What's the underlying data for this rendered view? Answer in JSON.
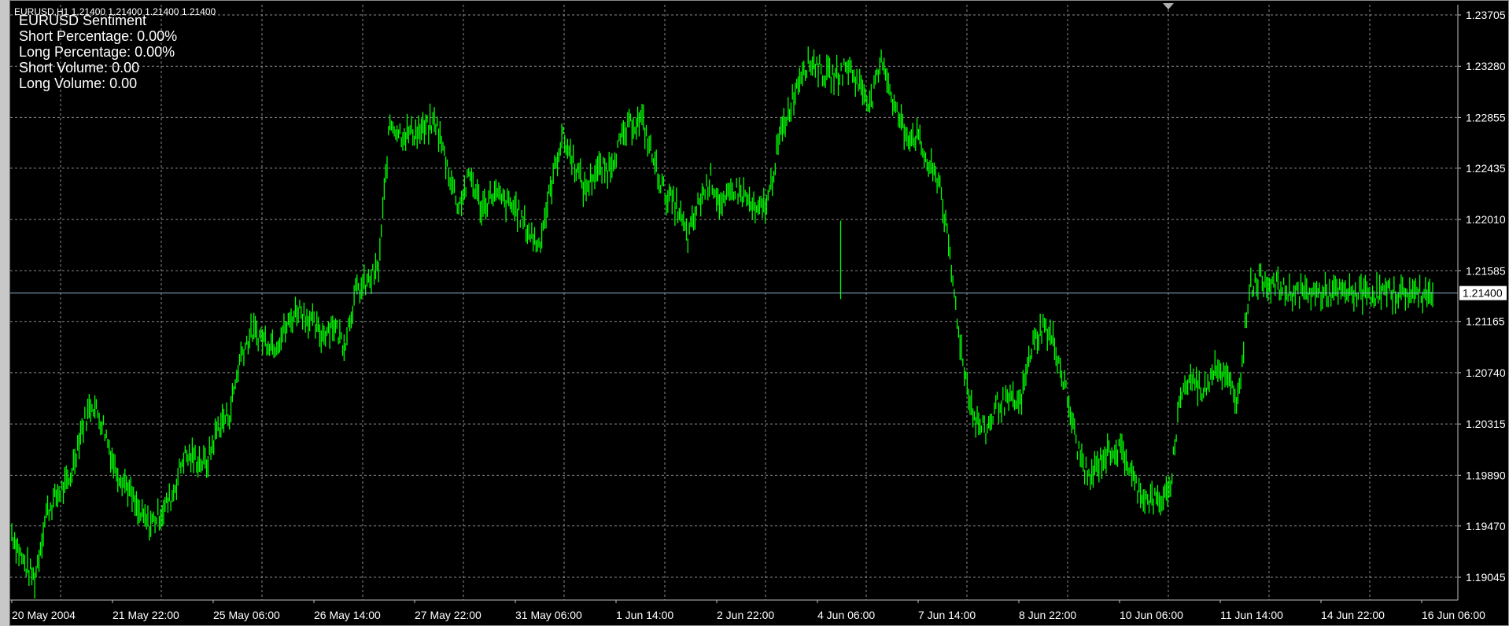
{
  "window": {
    "symbol_line": "EURUSD,H1  1.21400 1.21400 1.21400 1.21400"
  },
  "indicator": {
    "title": "EURUSD Sentiment",
    "short_percentage": "Short Percentage: 0.00%",
    "long_percentage": "Long Percentage: 0.00%",
    "short_volume": "Short Volume: 0.00",
    "long_volume": "Long Volume: 0.00"
  },
  "chart_data": {
    "type": "line",
    "chart_style": "bars",
    "symbol": "EURUSD",
    "timeframe": "H1",
    "background_color": "#000000",
    "series_color": "#00ff00",
    "grid": true,
    "grid_color": "#8a8a8a",
    "grid_style": "dashed",
    "price_ticks": [
      "1.23705",
      "1.23280",
      "1.22855",
      "1.22435",
      "1.22010",
      "1.21585",
      "1.21165",
      "1.20740",
      "1.20315",
      "1.19890",
      "1.19470",
      "1.19045"
    ],
    "current_price": "1.21400",
    "current_price_line_color": "#8cb4d0",
    "time_labels": [
      "20 May 2004",
      "21 May 22:00",
      "25 May 06:00",
      "26 May 14:00",
      "27 May 22:00",
      "31 May 06:00",
      "1 Jun 14:00",
      "2 Jun 22:00",
      "4 Jun 06:00",
      "7 Jun 14:00",
      "8 Jun 22:00",
      "10 Jun 06:00",
      "11 Jun 14:00",
      "14 Jun 22:00",
      "16 Jun 06:00"
    ],
    "ylim": [
      1.1888,
      1.2375
    ],
    "series": [
      {
        "name": "EURUSD",
        "x": [
          0,
          12,
          24,
          36,
          48,
          60,
          72,
          84,
          96,
          108,
          120,
          132,
          144,
          156,
          168,
          180,
          192,
          204,
          216,
          228,
          240,
          252,
          264,
          276,
          288,
          300,
          312,
          324,
          336,
          348,
          360,
          372,
          384,
          396,
          408,
          420,
          432,
          444,
          456,
          468,
          480,
          492,
          504,
          516,
          528,
          540,
          552,
          564,
          576,
          588,
          600,
          612,
          624,
          636,
          648,
          660,
          672,
          684,
          696,
          708,
          720,
          732,
          744,
          756,
          768,
          780,
          792,
          804,
          816,
          828,
          840,
          852,
          864,
          876,
          888,
          900,
          912,
          924,
          936,
          948,
          960,
          972,
          984,
          996,
          1008,
          1020,
          1032,
          1044,
          1056,
          1068,
          1080,
          1092,
          1104,
          1116,
          1128,
          1140,
          1152,
          1164,
          1176,
          1188,
          1200,
          1212,
          1224,
          1236,
          1248,
          1260,
          1272,
          1284,
          1296,
          1308,
          1320,
          1332,
          1344,
          1356,
          1368,
          1380,
          1392,
          1404,
          1416,
          1428,
          1440,
          1452,
          1464,
          1476,
          1488
        ],
        "values": [
          1.1942,
          1.1917,
          1.1903,
          1.1958,
          1.1973,
          1.1983,
          1.2025,
          1.205,
          1.203,
          1.1995,
          1.1982,
          1.1958,
          1.1948,
          1.1958,
          1.1972,
          1.2005,
          1.2003,
          1.1998,
          1.203,
          1.204,
          1.209,
          1.2108,
          1.2102,
          1.2098,
          1.2112,
          1.2128,
          1.2118,
          1.2105,
          1.2115,
          1.2098,
          1.214,
          1.2148,
          1.216,
          1.2282,
          1.2272,
          1.2273,
          1.2275,
          1.2282,
          1.2245,
          1.2212,
          1.2238,
          1.221,
          1.2223,
          1.2215,
          1.221,
          1.2192,
          1.218,
          1.2225,
          1.227,
          1.225,
          1.2225,
          1.2242,
          1.2242,
          1.2263,
          1.228,
          1.2283,
          1.225,
          1.2222,
          1.2212,
          1.2185,
          1.2216,
          1.2235,
          1.221,
          1.2227,
          1.222,
          1.2205,
          1.2217,
          1.2268,
          1.2297,
          1.2327,
          1.2332,
          1.232,
          1.232,
          1.2328,
          1.2312,
          1.2298,
          1.2335,
          1.2295,
          1.2272,
          1.227,
          1.2245,
          1.2232,
          1.2158,
          1.2082,
          1.2036,
          1.2025,
          1.2048,
          1.205,
          1.2048,
          1.2095,
          1.2113,
          1.2098,
          1.2058,
          1.2012,
          1.1985,
          1.2001,
          1.2011,
          1.2008,
          1.1982,
          1.197,
          1.1968,
          1.1972,
          1.2058,
          1.2069,
          1.2058,
          1.2082,
          1.2068,
          1.2052,
          1.2145,
          1.2152,
          1.2148,
          1.2142,
          1.214,
          1.214,
          1.214,
          1.214,
          1.214,
          1.214,
          1.214,
          1.214,
          1.214,
          1.214,
          1.214,
          1.214,
          1.214
        ]
      }
    ]
  }
}
